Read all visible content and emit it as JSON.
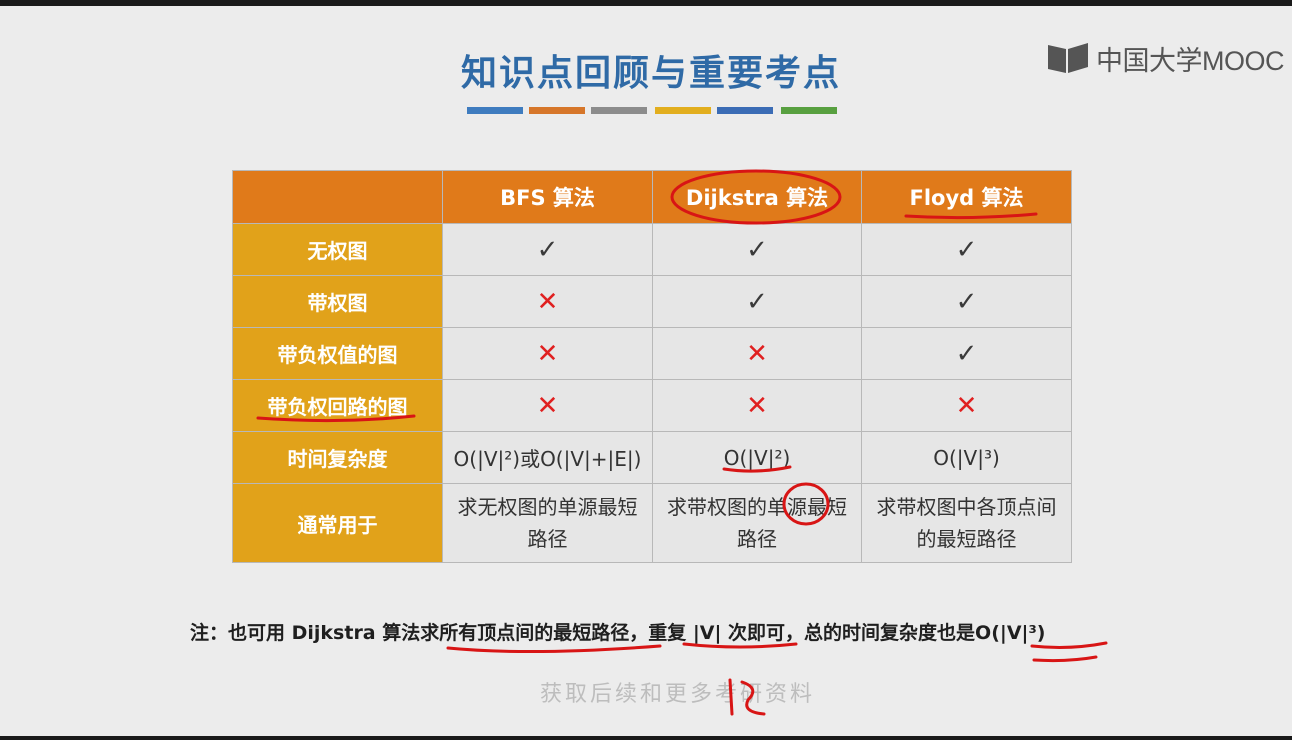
{
  "slide": {
    "title": "知识点回顾与重要考点",
    "title_color": "#2f6aa6",
    "color_bars": [
      "#3f7cbf",
      "#d6762a",
      "#8c8c8c",
      "#e2ae1e",
      "#3b6cb5",
      "#58a040"
    ],
    "logo_text": "中国大学MOOC"
  },
  "table": {
    "columns": [
      "",
      "BFS 算法",
      "Dijkstra 算法",
      "Floyd 算法"
    ],
    "rows": [
      {
        "label": "无权图",
        "cells": [
          "check",
          "check",
          "check"
        ]
      },
      {
        "label": "带权图",
        "cells": [
          "cross",
          "check",
          "check"
        ]
      },
      {
        "label": "带负权值的图",
        "cells": [
          "cross",
          "cross",
          "check"
        ]
      },
      {
        "label": "带负权回路的图",
        "cells": [
          "cross",
          "cross",
          "cross"
        ]
      },
      {
        "label": "时间复杂度",
        "cells": [
          "O(|V|²)或O(|V|+|E|)",
          "O(|V|²)",
          "O(|V|³)"
        ]
      },
      {
        "label": "通常用于",
        "cells": [
          "求无权图的单源最短路径",
          "求带权图的单源最短路径",
          "求带权图中各顶点间的最短路径"
        ]
      }
    ],
    "header_color": "#e07a1a",
    "rowhead_color": "#e1a21a"
  },
  "symbols": {
    "check": "✓",
    "cross": "✕"
  },
  "note": "注：也可用 Dijkstra 算法求所有顶点间的最短路径，重复 |V| 次即可，总的时间复杂度也是O(|V|³)",
  "watermark": "获取后续和更多考研资料"
}
